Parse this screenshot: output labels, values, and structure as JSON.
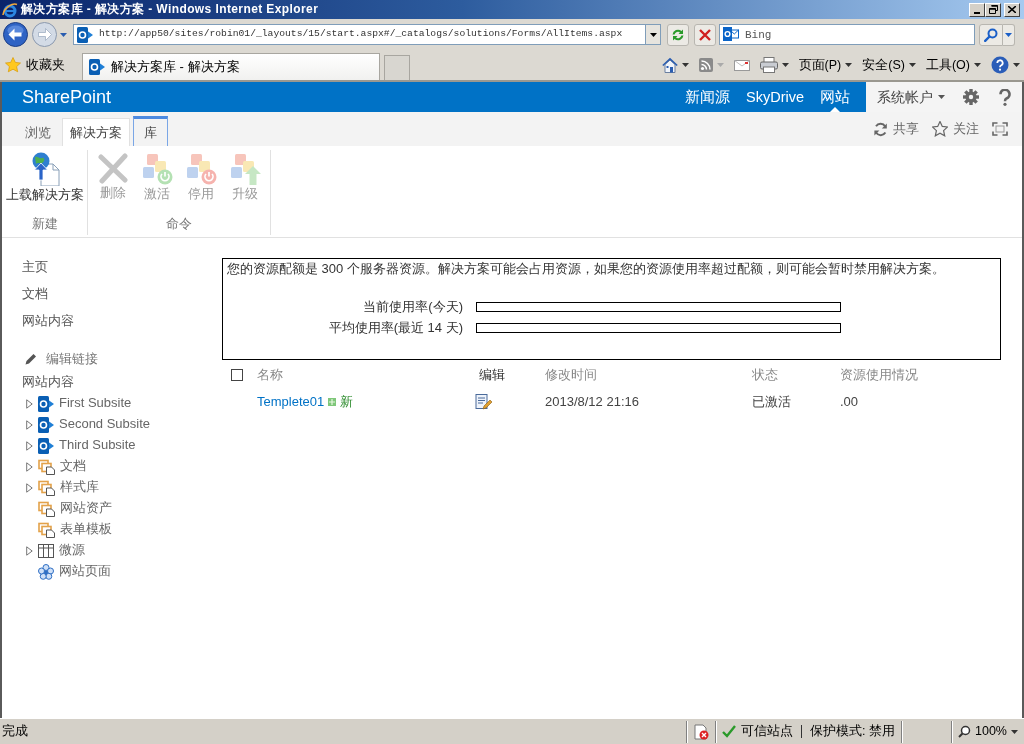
{
  "window": {
    "title": "解决方案库 - 解决方案 - Windows Internet Explorer"
  },
  "address_bar": {
    "url": "http://app50/sites/robin01/_layouts/15/start.aspx#/_catalogs/solutions/Forms/AllItems.aspx"
  },
  "search": {
    "placeholder": "Bing"
  },
  "favorites_bar": {
    "label": "收藏夹",
    "tabs": [
      {
        "title": "解决方案库 - 解决方案",
        "selected": true
      }
    ]
  },
  "command_bar": {
    "menus": [
      {
        "label": "页面(P)"
      },
      {
        "label": "安全(S)"
      },
      {
        "label": "工具(O)"
      }
    ]
  },
  "suite_bar": {
    "brand": "SharePoint",
    "links": [
      {
        "label": "新闻源",
        "selected": false
      },
      {
        "label": "SkyDrive",
        "selected": false
      },
      {
        "label": "网站",
        "selected": true
      }
    ],
    "account": "系统帐户"
  },
  "ribbon": {
    "tabs": [
      {
        "label": "浏览",
        "selected": false,
        "kind": "standard"
      },
      {
        "label": "解决方案",
        "selected": true,
        "kind": "standard"
      },
      {
        "label": "库",
        "selected": false,
        "kind": "contextual"
      }
    ],
    "actions": [
      {
        "label": "共享",
        "kind": "share"
      },
      {
        "label": "关注",
        "kind": "follow"
      }
    ],
    "groups": [
      {
        "label": "新建",
        "buttons": [
          {
            "label": "上载解决方案",
            "kind": "upload",
            "disabled": false
          }
        ]
      },
      {
        "label": "命令",
        "buttons": [
          {
            "label": "删除",
            "kind": "delete",
            "disabled": true
          },
          {
            "label": "激活",
            "kind": "activate",
            "disabled": true
          },
          {
            "label": "停用",
            "kind": "deactivate",
            "disabled": true
          },
          {
            "label": "升级",
            "kind": "upgrade",
            "disabled": true
          }
        ]
      }
    ]
  },
  "left_nav": {
    "links": [
      {
        "label": "主页"
      },
      {
        "label": "文档"
      },
      {
        "label": "网站内容"
      }
    ],
    "edit_links": "编辑链接",
    "tree_heading": "网站内容",
    "tree": [
      {
        "label": "First Subsite",
        "kind": "site",
        "expandable": true
      },
      {
        "label": "Second Subsite",
        "kind": "site",
        "expandable": true
      },
      {
        "label": "Third Subsite",
        "kind": "site",
        "expandable": true
      },
      {
        "label": "文档",
        "kind": "library",
        "expandable": true
      },
      {
        "label": "样式库",
        "kind": "library",
        "expandable": true
      },
      {
        "label": "网站资产",
        "kind": "library",
        "expandable": false
      },
      {
        "label": "表单模板",
        "kind": "library",
        "expandable": false
      },
      {
        "label": "微源",
        "kind": "list",
        "expandable": true
      },
      {
        "label": "网站页面",
        "kind": "pages",
        "expandable": false
      }
    ]
  },
  "quota": {
    "text": "您的资源配额是 300 个服务器资源。解决方案可能会占用资源，如果您的资源使用率超过配额，则可能会暂时禁用解决方案。",
    "meters": [
      {
        "label": "当前使用率(今天)",
        "level": 0
      },
      {
        "label": "平均使用率(最近 14 天)",
        "level": 0
      }
    ]
  },
  "table": {
    "select_all": {
      "checked": false
    },
    "columns": [
      {
        "label": "名称"
      },
      {
        "label": "编辑"
      },
      {
        "label": "修改时间"
      },
      {
        "label": "状态"
      },
      {
        "label": "资源使用情况"
      }
    ],
    "rows": [
      {
        "name": "Templete01",
        "badge": "新",
        "modified": "2013/8/12 21:16",
        "status": "已激活",
        "usage": ".00"
      }
    ]
  },
  "status_bar": {
    "text": "完成",
    "zone": "可信站点",
    "protected_mode": "保护模式: 禁用",
    "zoom": "100%"
  }
}
